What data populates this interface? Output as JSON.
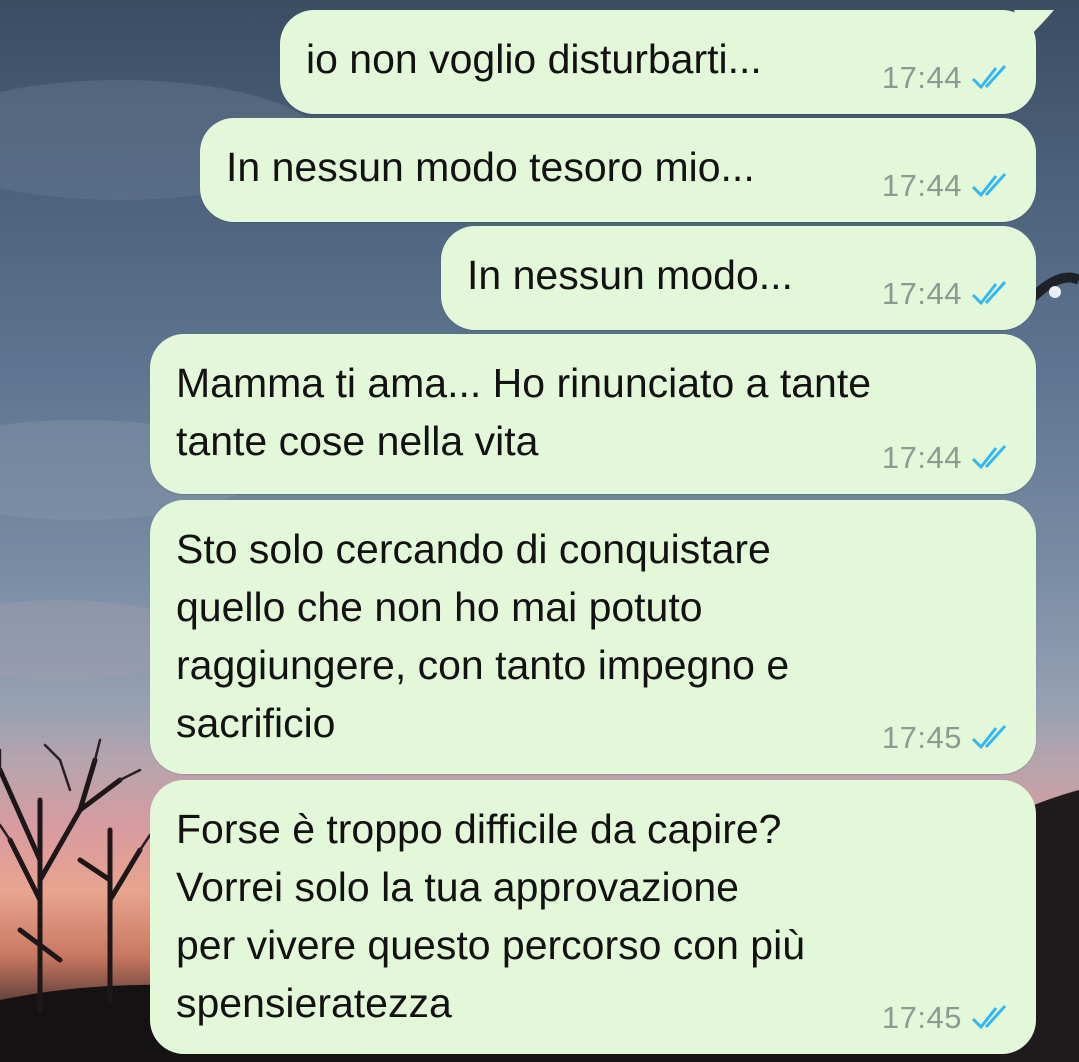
{
  "colors": {
    "bubble": "#e3f8d9",
    "text": "#121212",
    "time": "#8d9a93",
    "read_ticks": "#34b7f1"
  },
  "messages": [
    {
      "text": "io non voglio disturbarti...",
      "time": "17:44",
      "status_icon": "double-check-read-icon"
    },
    {
      "text": "In nessun modo tesoro mio...",
      "time": "17:44",
      "status_icon": "double-check-read-icon"
    },
    {
      "text": "In nessun modo...",
      "time": "17:44",
      "status_icon": "double-check-read-icon"
    },
    {
      "text": "Mamma ti ama... Ho rinunciato a tante\ntante cose nella vita",
      "time": "17:44",
      "status_icon": "double-check-read-icon"
    },
    {
      "text": "Sto solo cercando di conquistare\nquello che non ho mai potuto\nraggiungere, con tanto impegno e\nsacrificio",
      "time": "17:45",
      "status_icon": "double-check-read-icon"
    },
    {
      "text": "Forse è troppo difficile da capire?\nVorrei solo la tua approvazione\nper vivere questo percorso con più\nspensieratezza",
      "time": "17:45",
      "status_icon": "double-check-read-icon"
    }
  ]
}
